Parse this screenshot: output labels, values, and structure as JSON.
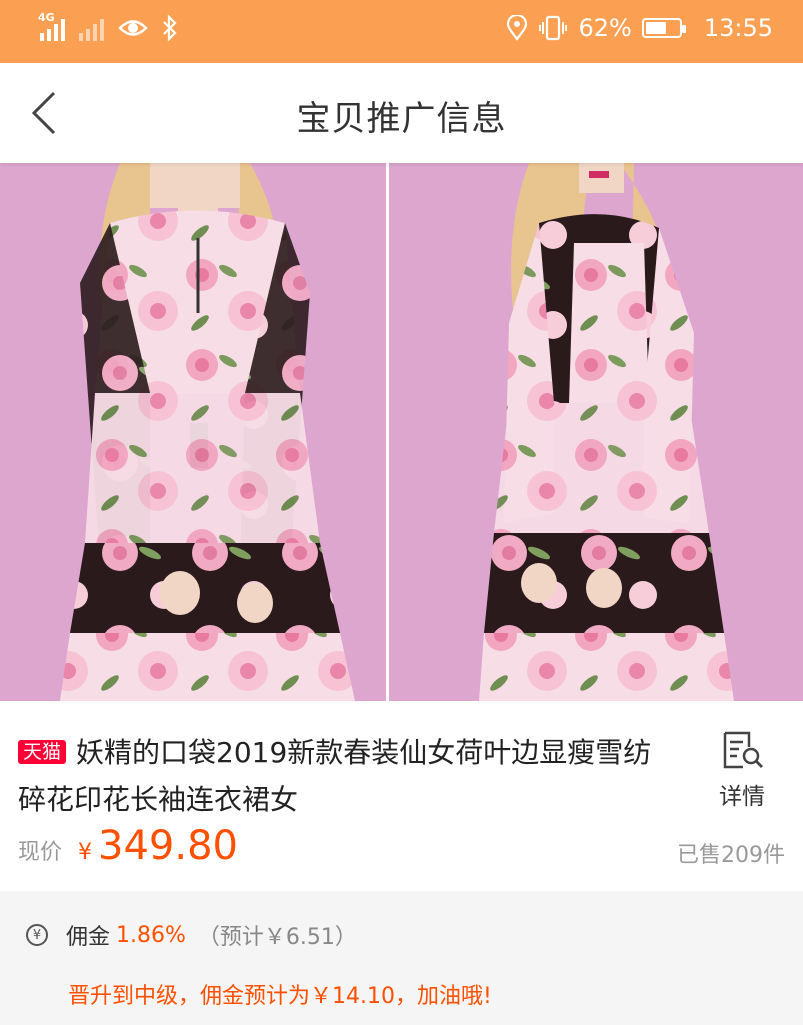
{
  "status_bar": {
    "network_label": "4G",
    "battery": "62%",
    "battery_level": 0.62,
    "time": "13:55",
    "icons": [
      "signal-icon",
      "no-signal-icon",
      "eye-icon",
      "bluetooth-icon",
      "location-icon",
      "vibrate-icon",
      "battery-icon"
    ]
  },
  "nav": {
    "back_icon": "chevron-left-icon",
    "title": "宝贝推广信息"
  },
  "product": {
    "badge": "天猫",
    "title": "妖精的口袋2019新款春装仙女荷叶边显瘦雪纺碎花印花长袖连衣裙女",
    "detail_label": "详情",
    "price_label": "现价",
    "currency": "¥",
    "price": "349.80",
    "sold": "已售209件"
  },
  "commission": {
    "label": "佣金",
    "rate": "1.86%",
    "estimate": "（预计￥6.51）",
    "upgrade_msg": "晋升到中级，佣金预计为￥14.10，加油哦!"
  },
  "colors": {
    "status_bar": "#fba052",
    "accent": "#ff5000",
    "tmall_red": "#ff0036",
    "photo_background": "#dca6cf"
  }
}
